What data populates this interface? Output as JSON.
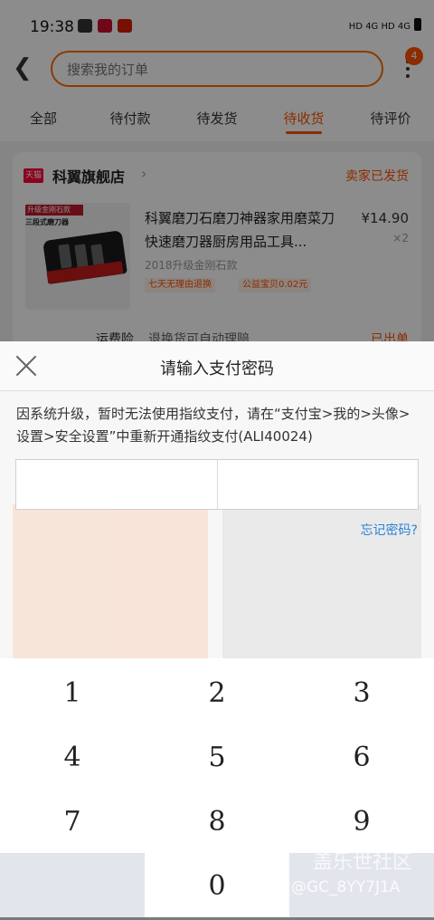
{
  "status_bar": {
    "time": "19:38",
    "right_text": "HD 4G HD 4G"
  },
  "search": {
    "placeholder": "搜索我的订单"
  },
  "menu": {
    "badge": "4"
  },
  "tabs": [
    {
      "label": "全部"
    },
    {
      "label": "待付款"
    },
    {
      "label": "待发货"
    },
    {
      "label": "待收货"
    },
    {
      "label": "待评价"
    }
  ],
  "order": {
    "shop_logo": "天猫",
    "shop_name": "科翼旗舰店",
    "status": "卖家已发货",
    "product_image_tag": "升级金刚石款",
    "product_image_subtitle": "三段式磨刀器",
    "title": "科翼磨刀石磨刀神器家用磨菜刀快速磨刀器厨房用品工具...",
    "price": "¥14.90",
    "quantity": "×2",
    "spec": "2018升级金刚石款",
    "chips": [
      "七天无理由退换",
      "公益宝贝0.02元"
    ],
    "insurance_label": "运费险",
    "insurance_text": "退换货可自动理赔",
    "insurance_right": "已出单"
  },
  "payment": {
    "title": "请输入支付密码",
    "notice": "因系统升级，暂时无法使用指纹支付，请在“支付宝>我的>头像>设置>安全设置”中重新开通指纹支付(ALI40024)",
    "forgot": "忘记密码?"
  },
  "keypad": [
    "1",
    "2",
    "3",
    "4",
    "5",
    "6",
    "7",
    "8",
    "9",
    "0"
  ],
  "watermark": {
    "line1": "盖乐世社区",
    "line2": "@GC_8YY7J1A"
  },
  "colors": {
    "accent": "#ff5000",
    "link": "#2a83d6",
    "keypad_blank": "#e2e5ec"
  }
}
